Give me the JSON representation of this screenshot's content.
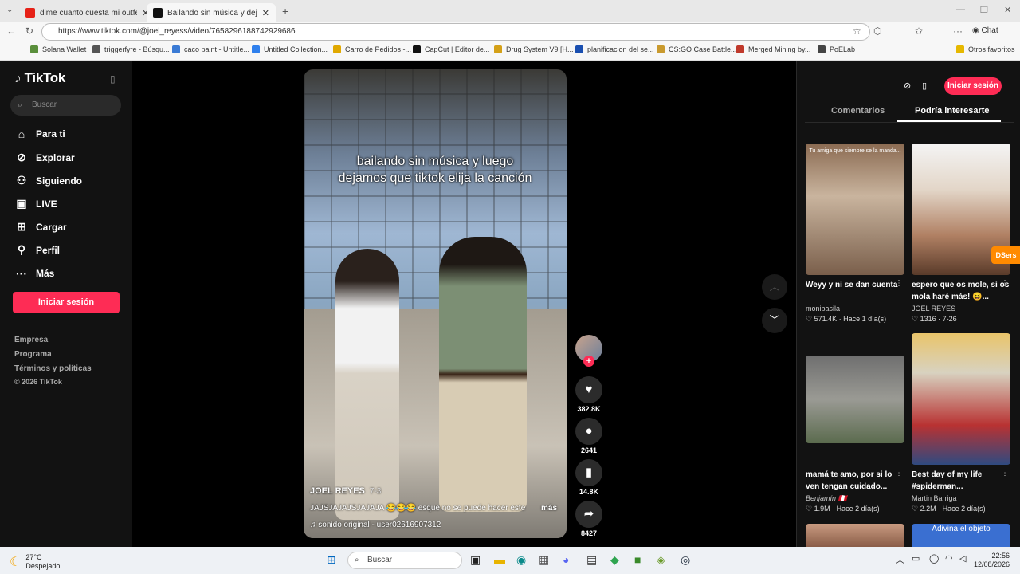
{
  "browser": {
    "tabs": [
      {
        "title": "dime cuanto cuesta mi outfeet cal",
        "favicon_color": "#e62117"
      },
      {
        "title": "Bailando sin música y dejando que",
        "favicon_color": "#111111"
      }
    ],
    "url": "https://www.tiktok.com/@joel_reyess/video/7658296188742929686",
    "chat_label": "Chat",
    "bookmarks": [
      "Solana Wallet",
      "triggerfyre - Búsqu...",
      "caco paint - Untitle...",
      "Untitled Collection...",
      "Carro de Pedidos -...",
      "CapCut | Editor de...",
      "Drug System V9 [H...",
      "planificacion del se...",
      "CS:GO Case Battle...",
      "Merged Mining by...",
      "PoELab"
    ],
    "other_favorites": "Otros favoritos"
  },
  "sidebar": {
    "logo": "TikTok",
    "search_placeholder": "Buscar",
    "nav": [
      {
        "label": "Para ti",
        "icon": "home-icon"
      },
      {
        "label": "Explorar",
        "icon": "compass-icon"
      },
      {
        "label": "Siguiendo",
        "icon": "following-icon"
      },
      {
        "label": "LIVE",
        "icon": "live-icon"
      },
      {
        "label": "Cargar",
        "icon": "upload-icon"
      },
      {
        "label": "Perfil",
        "icon": "profile-icon"
      },
      {
        "label": "Más",
        "icon": "more-icon"
      }
    ],
    "login_button": "Iniciar sesión",
    "footer": [
      "Empresa",
      "Programa",
      "Términos y políticas",
      "© 2026 TikTok"
    ]
  },
  "video": {
    "caption_line1": "bailando sin música y luego",
    "caption_line2": "dejamos que tiktok elija la canción",
    "author": "JOEL REYES",
    "date": "7-3",
    "description": "JAJSJAJAJSJAJAJA 😂😂😂 esque no se puede hacer este",
    "more_label": "más",
    "sound": "sonido original - user02616907312",
    "likes": "382.8K",
    "comments": "2641",
    "saves": "14.8K",
    "shares": "8427"
  },
  "right_panel": {
    "login_button": "Iniciar sesión",
    "tabs": [
      "Comentarios",
      "Podría interesarte"
    ],
    "cards": [
      {
        "title": "Weyy y ni se dan cuenta",
        "user": "monibasila",
        "likes": "571.4K",
        "time": "Hace 1 día(s)",
        "thumb_text": "Tu amiga que siempre se la manda..."
      },
      {
        "title": "espero que os mole, si os mola haré más! 😆...",
        "user": "JOEL REYES",
        "likes": "1316",
        "time": "7-26",
        "thumb_text": ""
      },
      {
        "title": "mamá te amo, por si lo ven tengan cuidado...",
        "user": "Benjamín 🇵🇪",
        "likes": "1.9M",
        "time": "Hace 2 día(s)",
        "thumb_text": ""
      },
      {
        "title": "Best day of my life #spiderman...",
        "user": "Martin Barriga",
        "likes": "2.2M",
        "time": "Hace 2 día(s)",
        "thumb_text": ""
      }
    ],
    "bottom_thumb_text": "Adivina el objeto",
    "extension_badge": "DSers"
  },
  "taskbar": {
    "temperature": "27°C",
    "weather": "Despejado",
    "search": "Buscar",
    "time": "22:56",
    "date": "12/08/2026"
  }
}
